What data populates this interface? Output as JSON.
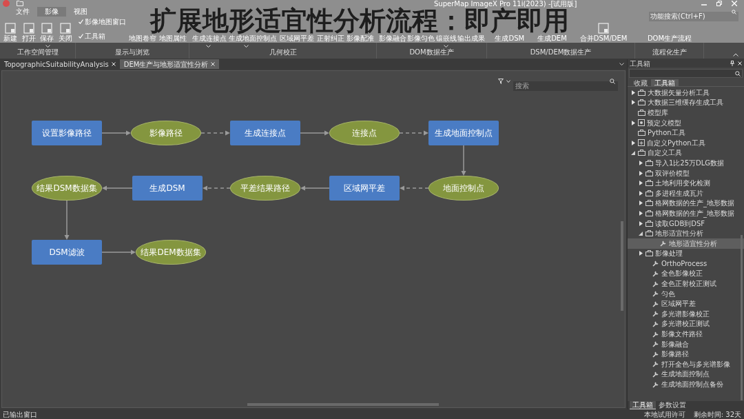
{
  "caption": "扩展地形适宜性分析流程：即产即用",
  "window": {
    "title": "SuperMap ImageX Pro 11i(2023) -[试用版]",
    "search": {
      "placeholder": "功能搜索(Ctrl+F)"
    }
  },
  "ribbon_tabs": [
    {
      "label": "文件",
      "selected": false
    },
    {
      "label": "影像",
      "selected": true
    },
    {
      "label": "视图",
      "selected": false
    }
  ],
  "ribbon_groups": [
    {
      "label": "工作空间管理",
      "buttons": [
        {
          "label": "新建",
          "kind": "button"
        },
        {
          "label": "打开",
          "kind": "button"
        },
        {
          "label": "保存",
          "kind": "dropdown"
        },
        {
          "label": "关闭",
          "kind": "button"
        }
      ]
    },
    {
      "label": "显示与浏览",
      "buttons": [
        {
          "label": "影像地图窗口",
          "kind": "check",
          "checked": true
        },
        {
          "label": "工具箱",
          "kind": "check",
          "checked": true
        },
        {
          "label": "地图卷帘",
          "kind": "button"
        },
        {
          "label": "地图属性",
          "kind": "button"
        }
      ]
    },
    {
      "label": "几何校正",
      "buttons": [
        {
          "label": "生成连接点",
          "kind": "dropdown"
        },
        {
          "label": "生成地面控制点",
          "kind": "dropdown"
        },
        {
          "label": "区域网平差",
          "kind": "button"
        },
        {
          "label": "正射纠正",
          "kind": "button"
        },
        {
          "label": "影像配准",
          "kind": "button"
        }
      ]
    },
    {
      "label": "DOM数据生产",
      "buttons": [
        {
          "label": "影像融合",
          "kind": "button"
        },
        {
          "label": "影像匀色",
          "kind": "button"
        },
        {
          "label": "镶嵌线",
          "kind": "dropdown"
        },
        {
          "label": "输出成果",
          "kind": "button"
        }
      ]
    },
    {
      "label": "DSM/DEM数据生产",
      "buttons": [
        {
          "label": "生成DSM",
          "kind": "button"
        },
        {
          "label": "生成DEM",
          "kind": "button"
        },
        {
          "label": "合并DSM/DEM",
          "kind": "button"
        }
      ]
    },
    {
      "label": "流程化生产",
      "buttons": [
        {
          "label": "DOM生产流程",
          "kind": "button"
        }
      ]
    }
  ],
  "doc_tabs": [
    {
      "label": "TopographicSuitabilityAnalysis",
      "selected": false
    },
    {
      "label": "DEM生产与地形适宜性分析",
      "selected": true
    }
  ],
  "canvas_search": {
    "placeholder": "搜索"
  },
  "flow": {
    "nodes": [
      {
        "label": "设置影像路径",
        "kind": "process"
      },
      {
        "label": "影像路径",
        "kind": "data"
      },
      {
        "label": "生成连接点",
        "kind": "process"
      },
      {
        "label": "连接点",
        "kind": "data"
      },
      {
        "label": "生成地面控制点",
        "kind": "process"
      },
      {
        "label": "结果DSM数据集",
        "kind": "data"
      },
      {
        "label": "生成DSM",
        "kind": "process"
      },
      {
        "label": "平差结果路径",
        "kind": "data"
      },
      {
        "label": "区域网平差",
        "kind": "process"
      },
      {
        "label": "地面控制点",
        "kind": "data"
      },
      {
        "label": "DSM滤波",
        "kind": "process"
      },
      {
        "label": "结果DEM数据集",
        "kind": "data"
      }
    ],
    "edges": [
      {
        "dashed": false
      },
      {
        "dashed": true
      },
      {
        "dashed": false
      },
      {
        "dashed": true
      },
      {
        "dashed": false
      },
      {
        "dashed": true
      },
      {
        "dashed": false
      },
      {
        "dashed": true
      },
      {
        "dashed": false
      },
      {
        "dashed": false
      },
      {
        "dashed": false
      }
    ]
  },
  "toolbox": {
    "title": "工具箱",
    "tabs": [
      {
        "label": "收藏",
        "selected": false
      },
      {
        "label": "工具箱",
        "selected": true
      }
    ],
    "tree": [
      {
        "label": "大数据矢量分析工具",
        "kind": "folder",
        "expanded": false,
        "selected": false
      },
      {
        "label": "大数据三维缓存生成工具",
        "kind": "folder",
        "expanded": false,
        "selected": false
      },
      {
        "label": "模型库",
        "kind": "folder",
        "selected": false
      },
      {
        "label": "预定义模型",
        "kind": "model",
        "expanded": false,
        "selected": false
      },
      {
        "label": "Python工具",
        "kind": "folder",
        "selected": false
      },
      {
        "label": "自定义Python工具",
        "kind": "custom",
        "expanded": false,
        "selected": false
      },
      {
        "label": "自定义工具",
        "kind": "folder",
        "expanded": true,
        "selected": false,
        "children": [
          {
            "label": "导入1比25万DLG数据",
            "kind": "folder",
            "expanded": false,
            "selected": false
          },
          {
            "label": "双评价模型",
            "kind": "folder",
            "expanded": false,
            "selected": false
          },
          {
            "label": "土地利用变化检测",
            "kind": "folder",
            "expanded": false,
            "selected": false
          },
          {
            "label": "多进程生成瓦片",
            "kind": "folder",
            "expanded": false,
            "selected": false
          },
          {
            "label": "格网数据的生产_地形数据",
            "kind": "folder",
            "expanded": false,
            "selected": false
          },
          {
            "label": "格网数据的生产_地形数据",
            "kind": "folder",
            "expanded": false,
            "selected": false
          },
          {
            "label": "读取GDB到DSF",
            "kind": "folder",
            "expanded": false,
            "selected": false
          },
          {
            "label": "地形适宜性分析",
            "kind": "folder",
            "expanded": true,
            "selected": false,
            "children": [
              {
                "label": "地形适宜性分析",
                "kind": "tool",
                "selected": true
              }
            ]
          },
          {
            "label": "影像处理",
            "kind": "folder",
            "expanded": false,
            "selected": false
          },
          {
            "label": "OrthoProcess",
            "kind": "tool",
            "selected": false
          },
          {
            "label": "全色影像校正",
            "kind": "tool",
            "selected": false
          },
          {
            "label": "全色正射校正测试",
            "kind": "tool",
            "selected": false
          },
          {
            "label": "匀色",
            "kind": "tool",
            "selected": false
          },
          {
            "label": "区域网平差",
            "kind": "tool",
            "selected": false
          },
          {
            "label": "多光谱影像校正",
            "kind": "tool",
            "selected": false
          },
          {
            "label": "多光谱校正测试",
            "kind": "tool",
            "selected": false
          },
          {
            "label": "影像文件路径",
            "kind": "tool",
            "selected": false
          },
          {
            "label": "影像融合",
            "kind": "tool",
            "selected": false
          },
          {
            "label": "影像路径",
            "kind": "tool",
            "selected": false
          },
          {
            "label": "打开全色与多光谱影像",
            "kind": "tool",
            "selected": false
          },
          {
            "label": "生成地面控制点",
            "kind": "tool",
            "selected": false
          },
          {
            "label": "生成地面控制点备份",
            "kind": "tool",
            "selected": false
          }
        ]
      }
    ],
    "bottom_tabs": [
      {
        "label": "工具箱",
        "selected": true
      },
      {
        "label": "参数设置",
        "selected": false
      }
    ]
  },
  "status_bar": {
    "left": "已输出窗口",
    "license": "本地试用许可",
    "remaining": "剩余时间: 32天"
  }
}
